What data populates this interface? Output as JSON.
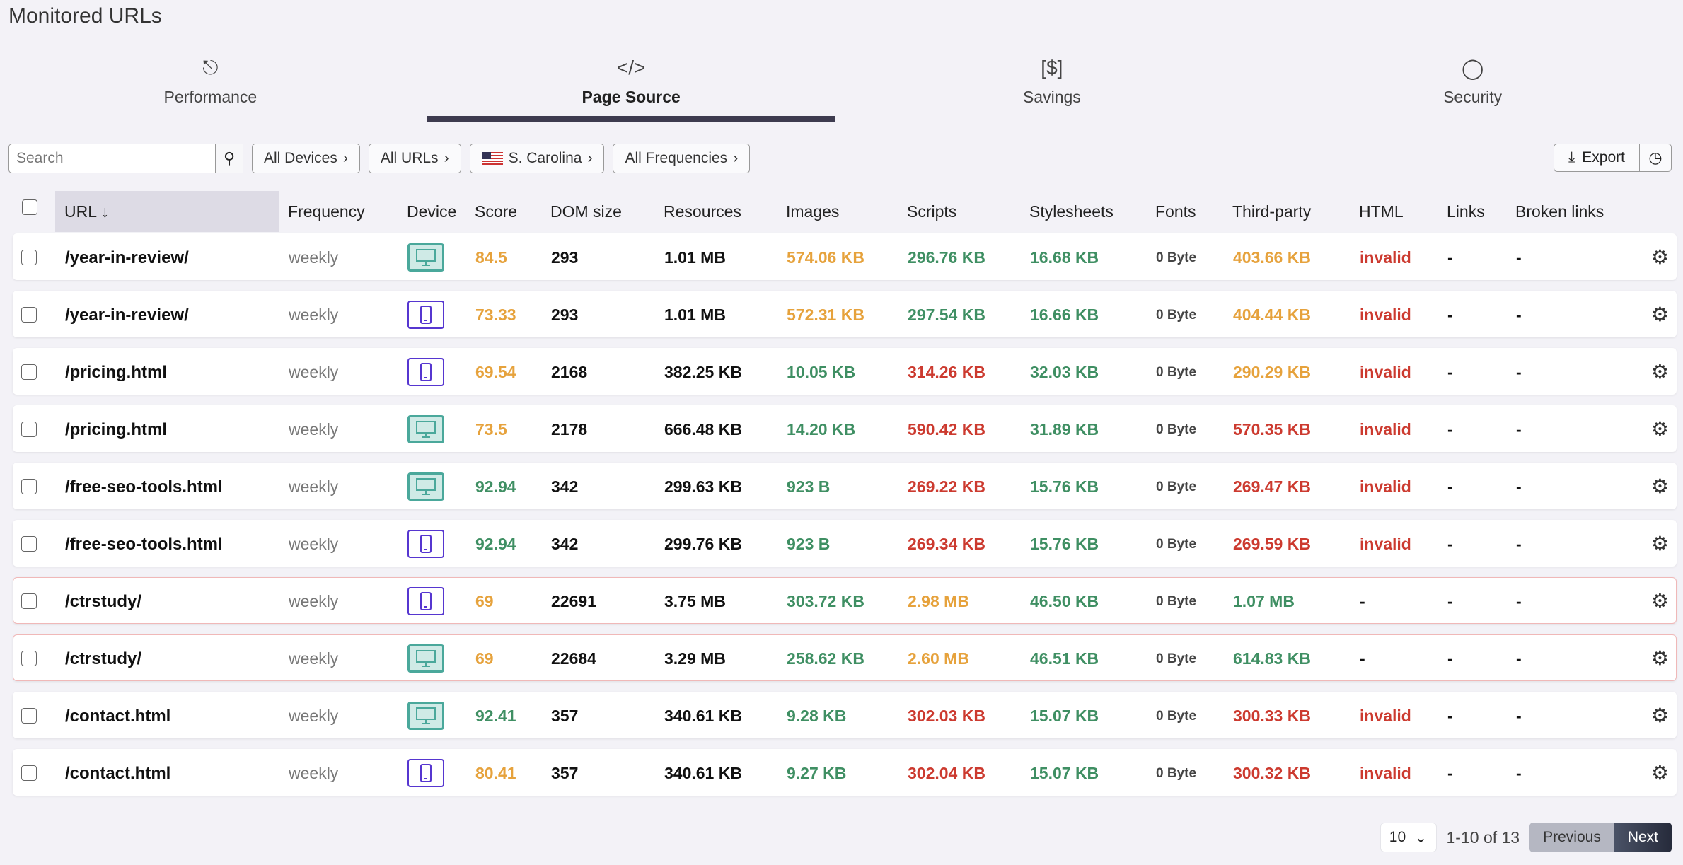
{
  "title": "Monitored URLs",
  "tabs": [
    {
      "label": "Performance",
      "icon": "lighthouse-icon"
    },
    {
      "label": "Page Source",
      "icon": "code-icon",
      "active": true
    },
    {
      "label": "Savings",
      "icon": "dollar-icon"
    },
    {
      "label": "Security",
      "icon": "shield-icon"
    }
  ],
  "filters": {
    "search_placeholder": "Search",
    "devices": "All Devices",
    "urls": "All URLs",
    "region": "S. Carolina",
    "frequencies": "All Frequencies"
  },
  "export_label": "Export",
  "columns": [
    "URL ↓",
    "Frequency",
    "Device",
    "Score",
    "DOM size",
    "Resources",
    "Images",
    "Scripts",
    "Stylesheets",
    "Fonts",
    "Third-party",
    "HTML",
    "Links",
    "Broken links"
  ],
  "colors": {
    "orange": "#e6a23c",
    "green": "#3f8f63",
    "red": "#cc3a2f"
  },
  "rows": [
    {
      "url": "/year-in-review/",
      "freq": "weekly",
      "device": "desktop",
      "score": [
        "84.5",
        "o"
      ],
      "dom": "293",
      "res": "1.01 MB",
      "img": [
        "574.06 KB",
        "o"
      ],
      "scr": [
        "296.76 KB",
        "g"
      ],
      "css": [
        "16.68 KB",
        "g"
      ],
      "fonts": "0 Byte",
      "tp": [
        "403.66 KB",
        "o"
      ],
      "html": [
        "invalid",
        "r"
      ],
      "links": "-",
      "broken": "-"
    },
    {
      "url": "/year-in-review/",
      "freq": "weekly",
      "device": "mobile",
      "score": [
        "73.33",
        "o"
      ],
      "dom": "293",
      "res": "1.01 MB",
      "img": [
        "572.31 KB",
        "o"
      ],
      "scr": [
        "297.54 KB",
        "g"
      ],
      "css": [
        "16.66 KB",
        "g"
      ],
      "fonts": "0 Byte",
      "tp": [
        "404.44 KB",
        "o"
      ],
      "html": [
        "invalid",
        "r"
      ],
      "links": "-",
      "broken": "-"
    },
    {
      "url": "/pricing.html",
      "freq": "weekly",
      "device": "mobile",
      "score": [
        "69.54",
        "o"
      ],
      "dom": "2168",
      "res": "382.25 KB",
      "img": [
        "10.05 KB",
        "g"
      ],
      "scr": [
        "314.26 KB",
        "r"
      ],
      "css": [
        "32.03 KB",
        "g"
      ],
      "fonts": "0 Byte",
      "tp": [
        "290.29 KB",
        "o"
      ],
      "html": [
        "invalid",
        "r"
      ],
      "links": "-",
      "broken": "-"
    },
    {
      "url": "/pricing.html",
      "freq": "weekly",
      "device": "desktop",
      "score": [
        "73.5",
        "o"
      ],
      "dom": "2178",
      "res": "666.48 KB",
      "img": [
        "14.20 KB",
        "g"
      ],
      "scr": [
        "590.42 KB",
        "r"
      ],
      "css": [
        "31.89 KB",
        "g"
      ],
      "fonts": "0 Byte",
      "tp": [
        "570.35 KB",
        "r"
      ],
      "html": [
        "invalid",
        "r"
      ],
      "links": "-",
      "broken": "-"
    },
    {
      "url": "/free-seo-tools.html",
      "freq": "weekly",
      "device": "desktop",
      "score": [
        "92.94",
        "g"
      ],
      "dom": "342",
      "res": "299.63 KB",
      "img": [
        "923 B",
        "g"
      ],
      "scr": [
        "269.22 KB",
        "r"
      ],
      "css": [
        "15.76 KB",
        "g"
      ],
      "fonts": "0 Byte",
      "tp": [
        "269.47 KB",
        "r"
      ],
      "html": [
        "invalid",
        "r"
      ],
      "links": "-",
      "broken": "-"
    },
    {
      "url": "/free-seo-tools.html",
      "freq": "weekly",
      "device": "mobile",
      "score": [
        "92.94",
        "g"
      ],
      "dom": "342",
      "res": "299.76 KB",
      "img": [
        "923 B",
        "g"
      ],
      "scr": [
        "269.34 KB",
        "r"
      ],
      "css": [
        "15.76 KB",
        "g"
      ],
      "fonts": "0 Byte",
      "tp": [
        "269.59 KB",
        "r"
      ],
      "html": [
        "invalid",
        "r"
      ],
      "links": "-",
      "broken": "-"
    },
    {
      "url": "/ctrstudy/",
      "freq": "weekly",
      "device": "mobile",
      "warn": true,
      "score": [
        "69",
        "o"
      ],
      "dom": "22691",
      "res": "3.75 MB",
      "img": [
        "303.72 KB",
        "g"
      ],
      "scr": [
        "2.98 MB",
        "o"
      ],
      "css": [
        "46.50 KB",
        "g"
      ],
      "fonts": "0 Byte",
      "tp": [
        "1.07 MB",
        "g"
      ],
      "html": [
        "-",
        "k"
      ],
      "links": "-",
      "broken": "-"
    },
    {
      "url": "/ctrstudy/",
      "freq": "weekly",
      "device": "desktop",
      "warn": true,
      "score": [
        "69",
        "o"
      ],
      "dom": "22684",
      "res": "3.29 MB",
      "img": [
        "258.62 KB",
        "g"
      ],
      "scr": [
        "2.60 MB",
        "o"
      ],
      "css": [
        "46.51 KB",
        "g"
      ],
      "fonts": "0 Byte",
      "tp": [
        "614.83 KB",
        "g"
      ],
      "html": [
        "-",
        "k"
      ],
      "links": "-",
      "broken": "-"
    },
    {
      "url": "/contact.html",
      "freq": "weekly",
      "device": "desktop",
      "score": [
        "92.41",
        "g"
      ],
      "dom": "357",
      "res": "340.61 KB",
      "img": [
        "9.28 KB",
        "g"
      ],
      "scr": [
        "302.03 KB",
        "r"
      ],
      "css": [
        "15.07 KB",
        "g"
      ],
      "fonts": "0 Byte",
      "tp": [
        "300.33 KB",
        "r"
      ],
      "html": [
        "invalid",
        "r"
      ],
      "links": "-",
      "broken": "-"
    },
    {
      "url": "/contact.html",
      "freq": "weekly",
      "device": "mobile",
      "score": [
        "80.41",
        "o"
      ],
      "dom": "357",
      "res": "340.61 KB",
      "img": [
        "9.27 KB",
        "g"
      ],
      "scr": [
        "302.04 KB",
        "r"
      ],
      "css": [
        "15.07 KB",
        "g"
      ],
      "fonts": "0 Byte",
      "tp": [
        "300.32 KB",
        "r"
      ],
      "html": [
        "invalid",
        "r"
      ],
      "links": "-",
      "broken": "-"
    }
  ],
  "pagination": {
    "page_size": "10",
    "range": "1-10 of 13",
    "prev": "Previous",
    "next": "Next"
  }
}
